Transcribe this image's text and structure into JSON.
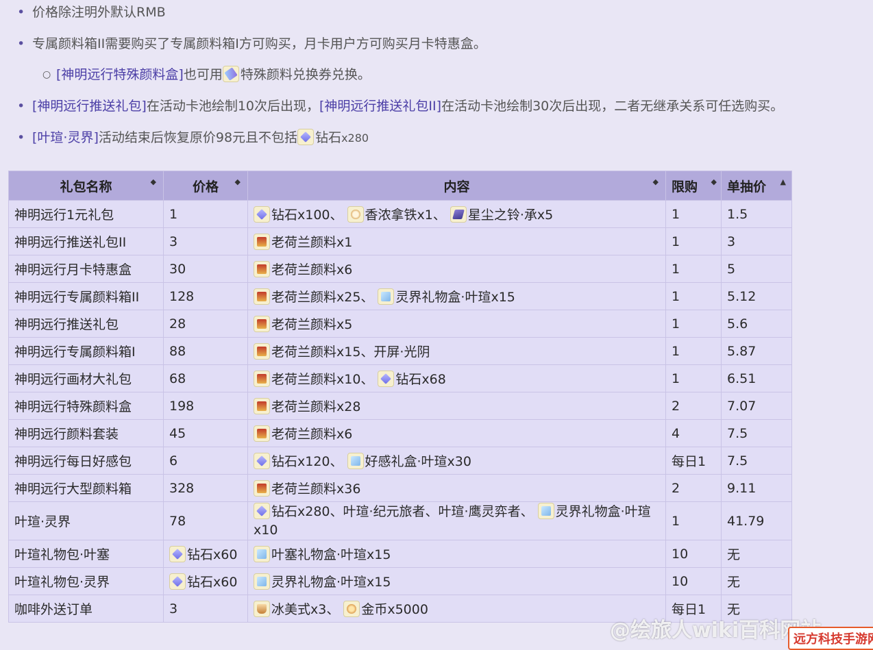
{
  "notes": [
    {
      "text": "价格除注明外默认RMB"
    },
    {
      "text": "专属颜料箱II需要购买了专属颜料箱I方可购买，月卡用户方可购买月卡特惠盒。"
    },
    {
      "a": "[神明远行特殊颜料盒]",
      "b": "也可用",
      "c": "特殊颜料兑换券兑换。"
    },
    {
      "a": "[神明远行推送礼包]",
      "b": "在活动卡池绘制10次后出现，",
      "c": "[神明远行推送礼包II]",
      "d": "在活动卡池绘制30次后出现，二者无继承关系可任选购买。"
    },
    {
      "a": "[叶瑄·灵界]",
      "b": "活动结束后恢复原价98元且不包括",
      "c": "钻石",
      "d": "x280"
    }
  ],
  "table": {
    "headers": [
      "礼包名称",
      "价格",
      "内容",
      "限购",
      "单抽价"
    ],
    "sort_icons": [
      "◆",
      "◆",
      "◆",
      "◆",
      "▲"
    ],
    "rows": [
      {
        "name": "神明远行1元礼包",
        "price": "1",
        "content": [
          "钻石x100、",
          "香浓拿铁x1、",
          "星尘之铃·承x5"
        ],
        "icons": [
          "diamond-icon",
          "coffee-icon",
          "bell-icon"
        ],
        "limit": "1",
        "unit": "1.5"
      },
      {
        "name": "神明远行推送礼包II",
        "price": "3",
        "content": [
          "老荷兰颜料x1"
        ],
        "icons": [
          "paint-icon"
        ],
        "limit": "1",
        "unit": "3"
      },
      {
        "name": "神明远行月卡特惠盒",
        "price": "30",
        "content": [
          "老荷兰颜料x6"
        ],
        "icons": [
          "paint-icon"
        ],
        "limit": "1",
        "unit": "5"
      },
      {
        "name": "神明远行专属颜料箱II",
        "price": "128",
        "content": [
          "老荷兰颜料x25、",
          "灵界礼物盒·叶瑄x15"
        ],
        "icons": [
          "paint-icon",
          "gift-icon"
        ],
        "limit": "1",
        "unit": "5.12"
      },
      {
        "name": "神明远行推送礼包",
        "price": "28",
        "content": [
          "老荷兰颜料x5"
        ],
        "icons": [
          "paint-icon"
        ],
        "limit": "1",
        "unit": "5.6"
      },
      {
        "name": "神明远行专属颜料箱I",
        "price": "88",
        "content": [
          "老荷兰颜料x15、开屏·光阴"
        ],
        "icons": [
          "paint-icon"
        ],
        "limit": "1",
        "unit": "5.87"
      },
      {
        "name": "神明远行画材大礼包",
        "price": "68",
        "content": [
          "老荷兰颜料x10、",
          "钻石x68"
        ],
        "icons": [
          "paint-icon",
          "diamond-icon"
        ],
        "limit": "1",
        "unit": "6.51"
      },
      {
        "name": "神明远行特殊颜料盒",
        "price": "198",
        "content": [
          "老荷兰颜料x28"
        ],
        "icons": [
          "paint-icon"
        ],
        "limit": "2",
        "unit": "7.07"
      },
      {
        "name": "神明远行颜料套装",
        "price": "45",
        "content": [
          "老荷兰颜料x6"
        ],
        "icons": [
          "paint-icon"
        ],
        "limit": "4",
        "unit": "7.5"
      },
      {
        "name": "神明远行每日好感包",
        "price": "6",
        "content": [
          "钻石x120、",
          "好感礼盒·叶瑄x30"
        ],
        "icons": [
          "diamond-icon",
          "gift-icon"
        ],
        "limit": "每日1",
        "unit": "7.5"
      },
      {
        "name": "神明远行大型颜料箱",
        "price": "328",
        "content": [
          "老荷兰颜料x36"
        ],
        "icons": [
          "paint-icon"
        ],
        "limit": "2",
        "unit": "9.11"
      },
      {
        "name": "叶瑄·灵界",
        "price": "78",
        "content": [
          "钻石x280、叶瑄·纪元旅者、叶瑄·鹰灵弈者、",
          "灵界礼物盒·叶瑄x10"
        ],
        "icons": [
          "diamond-icon",
          "gift-icon"
        ],
        "limit": "1",
        "unit": "41.79"
      },
      {
        "name": "叶瑄礼物包·叶塞",
        "price": "钻石x60",
        "price_icon": "diamond-icon",
        "content": [
          "叶塞礼物盒·叶瑄x15"
        ],
        "icons": [
          "gift-icon"
        ],
        "limit": "10",
        "unit": "无"
      },
      {
        "name": "叶瑄礼物包·灵界",
        "price": "钻石x60",
        "price_icon": "diamond-icon",
        "content": [
          "灵界礼物盒·叶瑄x15"
        ],
        "icons": [
          "gift-icon"
        ],
        "limit": "10",
        "unit": "无"
      },
      {
        "name": "咖啡外送订单",
        "price": "3",
        "content": [
          "冰美式x3、",
          "金币x5000"
        ],
        "icons": [
          "iced-coffee-icon",
          "coin-icon"
        ],
        "limit": "每日1",
        "unit": "无"
      }
    ]
  },
  "watermark": "@绘旅人wiki百科网站",
  "logo": "远方科技手游网"
}
